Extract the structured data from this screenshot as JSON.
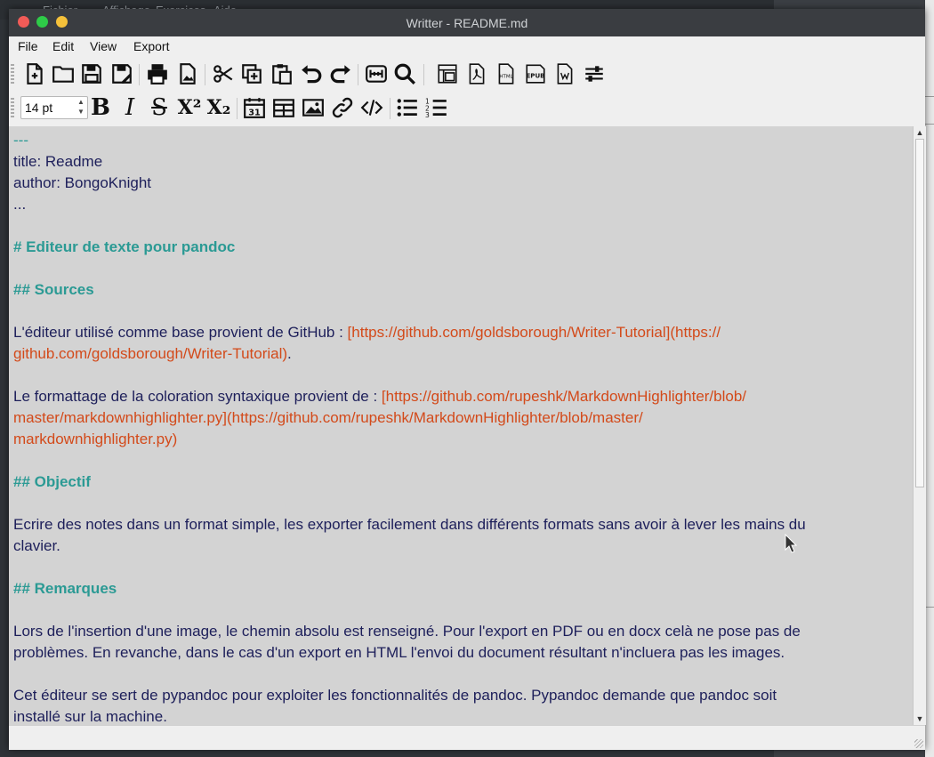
{
  "background_app": {
    "menu": [
      "Fichier",
      "Affichage",
      "Exercices",
      "Aide"
    ]
  },
  "window": {
    "title": "Writter - README.md"
  },
  "menubar": [
    "File",
    "Edit",
    "View",
    "Export"
  ],
  "toolbar_main": {
    "icons": [
      "new-file-icon",
      "open-folder-icon",
      "save-icon",
      "save-as-icon",
      "print-icon",
      "print-preview-icon",
      "cut-icon",
      "copy-icon",
      "paste-icon",
      "undo-icon",
      "redo-icon",
      "word-count-icon",
      "find-icon",
      "view-icon",
      "export-pdf-icon",
      "export-html-icon",
      "export-epub-icon",
      "export-docx-icon",
      "settings-icon"
    ]
  },
  "toolbar_format": {
    "font_size": "14 pt",
    "bold": "B",
    "italic": "I",
    "strike": "S",
    "superscript": "X²",
    "subscript": "X₂",
    "icons": [
      "calendar-icon",
      "table-icon",
      "image-icon",
      "link-icon",
      "code-icon",
      "bullet-list-icon",
      "numbered-list-icon"
    ],
    "calendar_day": "31"
  },
  "editor": {
    "lines": [
      {
        "type": "fm",
        "text": "---"
      },
      {
        "type": "plain",
        "text": "title: Readme"
      },
      {
        "type": "plain",
        "text": "author: BongoKnight"
      },
      {
        "type": "plain",
        "text": "..."
      },
      {
        "type": "blank",
        "text": ""
      },
      {
        "type": "heading",
        "text": "# Editeur de texte pour pandoc"
      },
      {
        "type": "blank",
        "text": ""
      },
      {
        "type": "heading",
        "text": "## Sources"
      },
      {
        "type": "blank",
        "text": ""
      },
      {
        "type": "mixed",
        "plain": "L'éditeur utilisé comme base provient de GitHub : ",
        "link": "[https://github.com/goldsborough/Writer-Tutorial](https://"
      },
      {
        "type": "mixed",
        "plain": "",
        "link": "github.com/goldsborough/Writer-Tutorial)",
        "tail": "."
      },
      {
        "type": "blank",
        "text": ""
      },
      {
        "type": "mixed",
        "plain": "Le formattage de la coloration syntaxique provient de : ",
        "link": "[https://github.com/rupeshk/MarkdownHighlighter/blob/"
      },
      {
        "type": "link",
        "text": "master/markdownhighlighter.py](https://github.com/rupeshk/MarkdownHighlighter/blob/master/"
      },
      {
        "type": "link",
        "text": "markdownhighlighter.py)"
      },
      {
        "type": "blank",
        "text": ""
      },
      {
        "type": "heading",
        "text": "## Objectif"
      },
      {
        "type": "blank",
        "text": ""
      },
      {
        "type": "plain",
        "text": "Ecrire des notes dans un format simple, les exporter facilement dans différents formats sans avoir à lever les mains du"
      },
      {
        "type": "plain",
        "text": "clavier."
      },
      {
        "type": "blank",
        "text": ""
      },
      {
        "type": "heading",
        "text": "## Remarques"
      },
      {
        "type": "blank",
        "text": ""
      },
      {
        "type": "plain",
        "text": "Lors de l'insertion d'une image, le chemin absolu est renseigné. Pour l'export en PDF ou en docx celà ne pose pas de"
      },
      {
        "type": "plain",
        "text": "problèmes. En revanche, dans le cas d'un export en HTML l'envoi du document résultant n'incluera pas les images."
      },
      {
        "type": "blank",
        "text": ""
      },
      {
        "type": "plain",
        "text": "Cet éditeur se sert de pypandoc pour exploiter les fonctionnalités de pandoc. Pypandoc demande que pandoc soit"
      },
      {
        "type": "plain",
        "text": "installé sur la machine."
      }
    ]
  },
  "colors": {
    "heading": "#2b9a94",
    "link": "#d34a1a",
    "text": "#1d1f5a",
    "editor_bg": "#d3d3d3"
  }
}
